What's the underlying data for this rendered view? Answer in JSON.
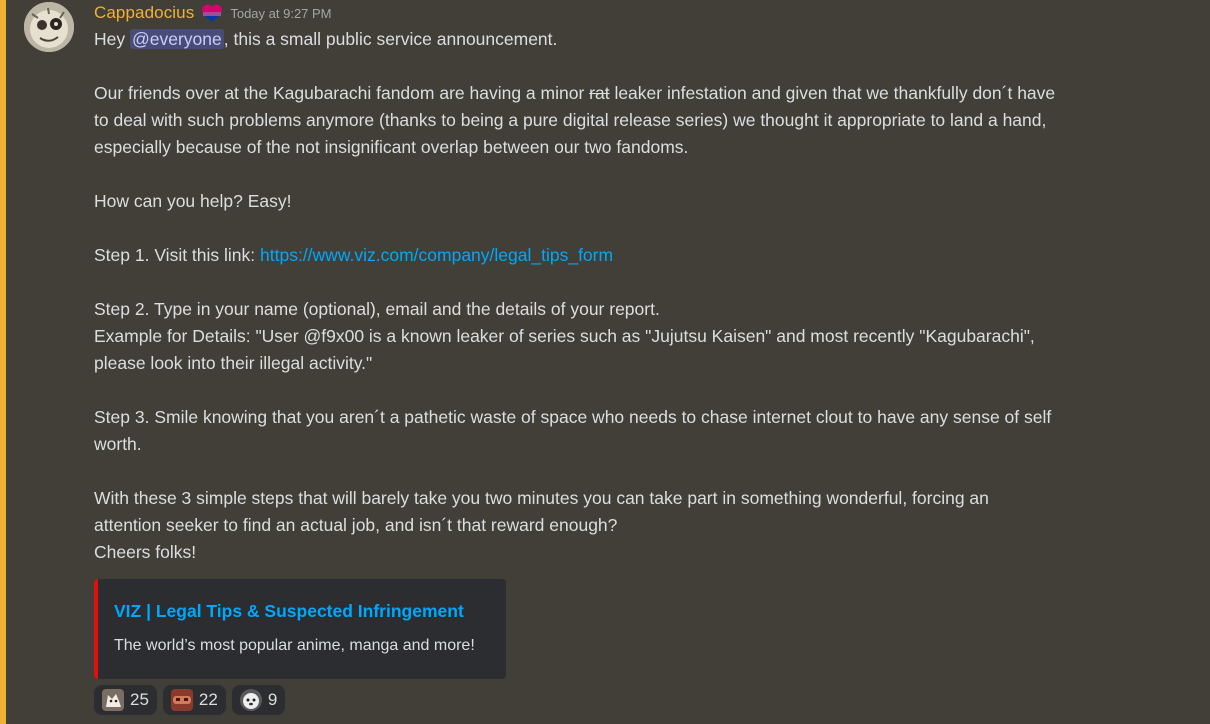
{
  "message": {
    "username": "Cappadocius",
    "timestamp": "Today at 9:27 PM",
    "line1_pre": "Hey ",
    "mention": "@everyone",
    "line1_post": ", this a small public service announcement.",
    "para2_pre": "Our friends over at the Kagubarachi fandom are having a minor ",
    "para2_strike": "rat",
    "para2_line1_post": " leaker infestation and given that we thankfully don´t have",
    "para2_line2": "to deal with such problems anymore (thanks to being a pure digital release series) we thought it appropriate to land a hand,",
    "para2_line3": "especially because of the not insignificant overlap between our two fandoms.",
    "para3": "How can you help? Easy!",
    "step1_pre": "Step 1. Visit this link: ",
    "step1_link": "https://www.viz.com/company/legal_tips_form",
    "step2": "Step 2. Type in your name (optional), email and the details of your report.",
    "example_line1": "Example for Details: \"User @f9x00 is a known leaker of series such as \"Jujutsu Kaisen\" and most recently \"Kagubarachi\",",
    "example_line2": "please look into their illegal activity.\"",
    "step3_line1": "Step 3. Smile knowing that you aren´t a pathetic waste of space who needs to chase internet clout to have any sense of self",
    "step3_line2": "worth.",
    "closing_line1": "With these 3 simple steps that will barely take you two minutes you can take part in something wonderful, forcing an",
    "closing_line2": "attention seeker to find an actual job, and isn´t that reward enough?",
    "closing_line3": "Cheers folks!"
  },
  "embed": {
    "title": "VIZ | Legal Tips & Suspected Infringement",
    "description": "The world’s most popular anime, manga and more!",
    "accent_color": "#e1100e"
  },
  "reactions": [
    {
      "emoji": "cat-emoji",
      "count": "25"
    },
    {
      "emoji": "face-emoji",
      "count": "22"
    },
    {
      "emoji": "dog-emoji",
      "count": "9"
    }
  ],
  "colors": {
    "background": "#423f38",
    "username": "#f0b232",
    "link": "#00a8fc",
    "mention_bg": "#5865f2"
  }
}
